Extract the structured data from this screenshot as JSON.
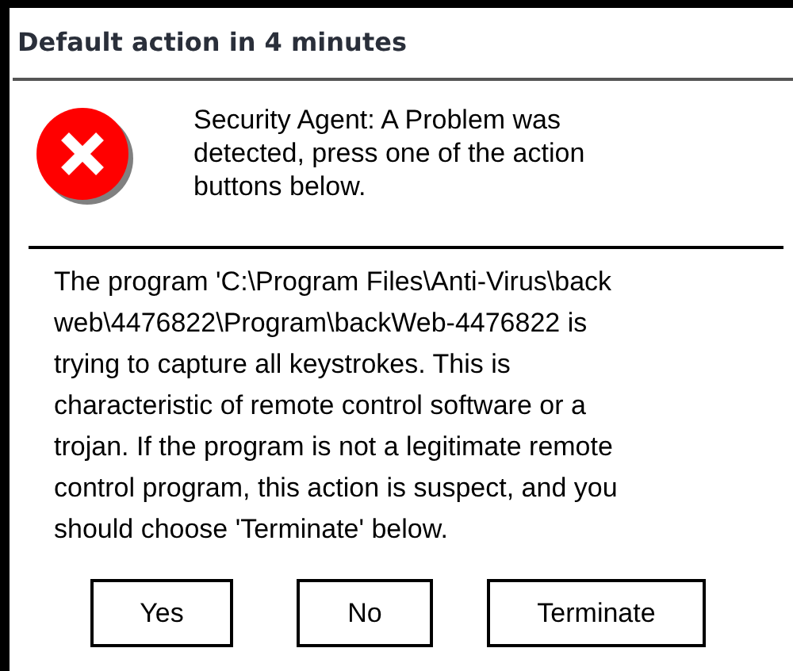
{
  "window": {
    "title": "Default action in 4 minutes"
  },
  "alert": {
    "kind": "error",
    "message": "Security Agent: A Problem was\ndetected, press one of the action\nbuttons below."
  },
  "details": "The program 'C:\\Program Files\\Anti-Virus\\back\nweb\\4476822\\Program\\backWeb-4476822 is\ntrying to capture all keystrokes. This is\ncharacteristic of remote control software or a\ntrojan. If the program is not a legitimate remote\ncontrol program, this action is suspect, and you\nshould choose 'Terminate' below.",
  "buttons": [
    "Yes",
    "No",
    "Terminate"
  ]
}
